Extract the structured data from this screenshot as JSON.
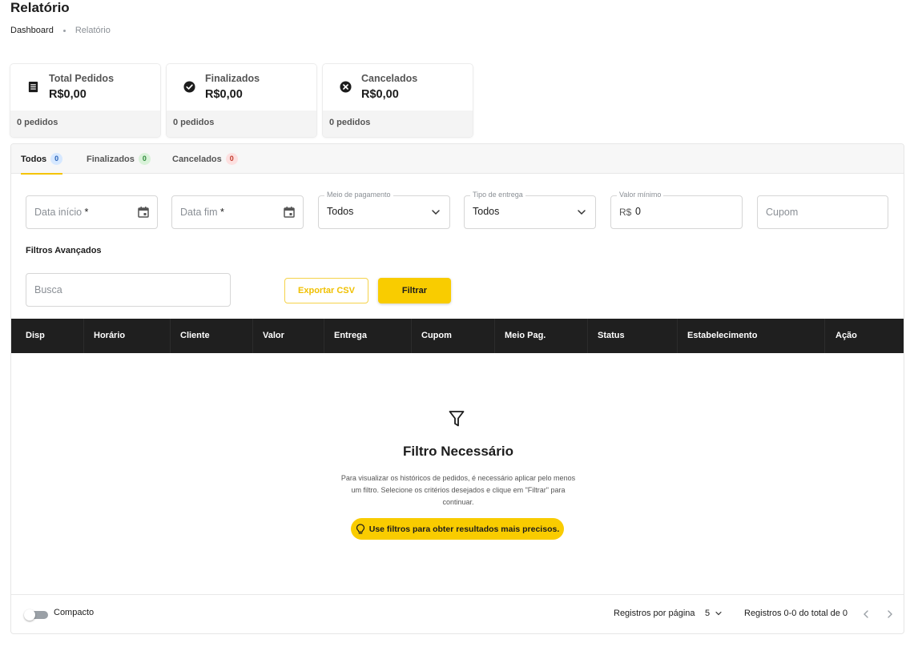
{
  "page": {
    "title": "Relatório",
    "breadcrumb": [
      "Dashboard",
      "Relatório"
    ]
  },
  "stats": [
    {
      "label": "Total Pedidos",
      "value": "R$0,00",
      "count": "0 pedidos",
      "icon": "receipt-icon"
    },
    {
      "label": "Finalizados",
      "value": "R$0,00",
      "count": "0 pedidos",
      "icon": "check-circle-icon"
    },
    {
      "label": "Cancelados",
      "value": "R$0,00",
      "count": "0 pedidos",
      "icon": "cancel-circle-icon"
    }
  ],
  "tabs": [
    {
      "label": "Todos",
      "count": "0",
      "active": true
    },
    {
      "label": "Finalizados",
      "count": "0"
    },
    {
      "label": "Cancelados",
      "count": "0"
    }
  ],
  "filters": {
    "start_date": {
      "placeholder": "Data início",
      "required": "*"
    },
    "end_date": {
      "placeholder": "Data fim",
      "required": "*"
    },
    "payment_method": {
      "label": "Meio de pagamento",
      "value": "Todos"
    },
    "delivery_type": {
      "label": "Tipo de entrega",
      "value": "Todos"
    },
    "min_value": {
      "label": "Valor mínimo",
      "prefix": "R$",
      "value": "0"
    },
    "coupon": {
      "placeholder": "Cupom"
    },
    "advanced_title": "Filtros Avançados",
    "search": {
      "placeholder": "Busca"
    },
    "export_label": "Exportar CSV",
    "filter_label": "Filtrar"
  },
  "table": {
    "columns": [
      "Disp",
      "Horário",
      "Cliente",
      "Valor",
      "Entrega",
      "Cupom",
      "Meio Pag.",
      "Status",
      "Estabelecimento",
      "Ação"
    ]
  },
  "empty_state": {
    "title": "Filtro Necessário",
    "description": "Para visualizar os históricos de pedidos, é necessário aplicar pelo menos um filtro. Selecione os critérios desejados e clique em \"Filtrar\" para continuar.",
    "hint": "Use filtros para obter resultados mais precisos."
  },
  "footer": {
    "compact_label": "Compacto",
    "per_page_label": "Registros por página",
    "per_page_value": "5",
    "range_label": "Registros 0-0 do total de 0"
  },
  "colors": {
    "accent": "#f9cc00",
    "header_bg": "#1f1f1f"
  }
}
